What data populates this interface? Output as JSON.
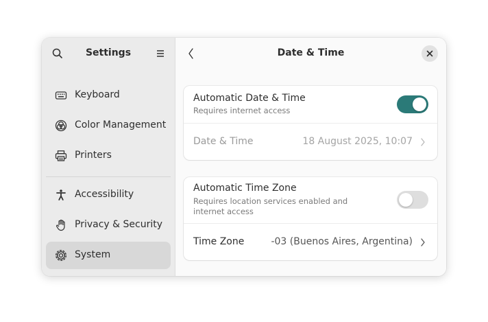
{
  "sidebar": {
    "title": "Settings",
    "items": [
      {
        "label": "Keyboard",
        "icon": "keyboard-icon"
      },
      {
        "label": "Color Management",
        "icon": "color-management-icon"
      },
      {
        "label": "Printers",
        "icon": "printer-icon"
      },
      {
        "label": "Accessibility",
        "icon": "accessibility-icon"
      },
      {
        "label": "Privacy & Security",
        "icon": "hand-icon"
      },
      {
        "label": "System",
        "icon": "system-gear-icon",
        "selected": true
      }
    ]
  },
  "content": {
    "title": "Date & Time",
    "auto_datetime": {
      "title": "Automatic Date & Time",
      "subtitle": "Requires internet access",
      "enabled": true
    },
    "datetime": {
      "title": "Date & Time",
      "value": "18 August 2025, 10:07"
    },
    "auto_timezone": {
      "title": "Automatic Time Zone",
      "subtitle": "Requires location services enabled and internet access",
      "enabled": false
    },
    "timezone": {
      "title": "Time Zone",
      "value": "-03 (Buenos Aires, Argentina)"
    }
  },
  "colors": {
    "accent": "#2b7a78",
    "switch_off": "#dedede",
    "sidebar_bg": "#ebebeb",
    "selected_bg": "#d8d8d8"
  }
}
